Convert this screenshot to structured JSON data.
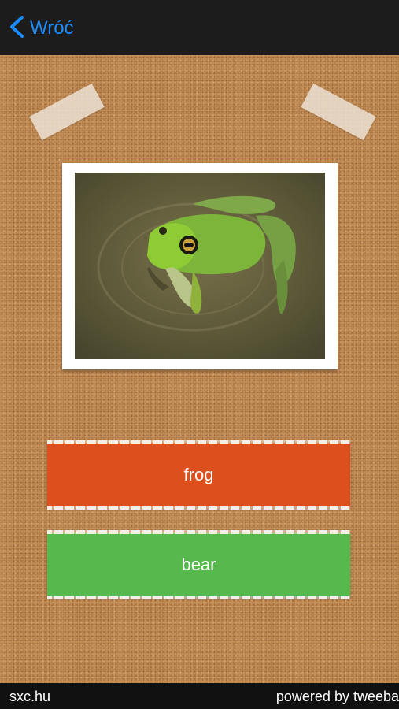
{
  "nav": {
    "back_label": "Wróć"
  },
  "question": {
    "image_subject": "frog-photo"
  },
  "answers": [
    {
      "label": "frog",
      "color": "#dd4f1d"
    },
    {
      "label": "bear",
      "color": "#57b94d"
    }
  ],
  "footer": {
    "source": "sxc.hu",
    "powered": "powered by tweeba"
  },
  "colors": {
    "accent": "#1a8cff",
    "cork": "#c8925a"
  }
}
